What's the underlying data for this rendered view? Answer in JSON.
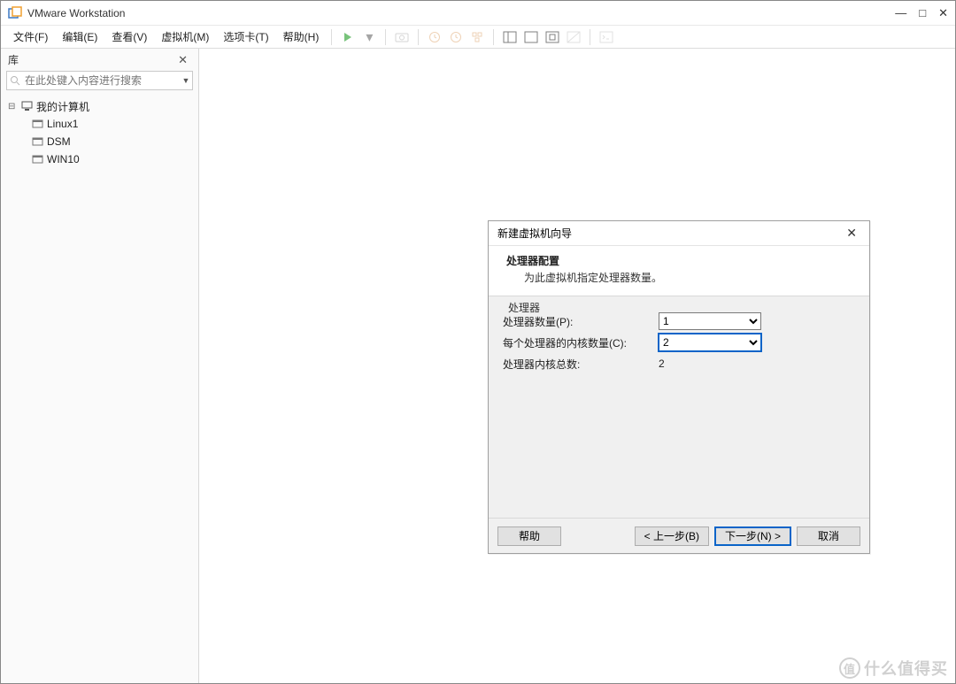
{
  "titlebar": {
    "app_name": "VMware Workstation"
  },
  "menubar": {
    "file": "文件(F)",
    "edit": "编辑(E)",
    "view": "查看(V)",
    "vm": "虚拟机(M)",
    "tabs": "选项卡(T)",
    "help": "帮助(H)"
  },
  "sidebar": {
    "title": "库",
    "search_placeholder": "在此处键入内容进行搜索",
    "root": "我的计算机",
    "items": [
      {
        "label": "Linux1"
      },
      {
        "label": "DSM"
      },
      {
        "label": "WIN10"
      }
    ]
  },
  "dialog": {
    "title": "新建虚拟机向导",
    "heading": "处理器配置",
    "subheading": "为此虚拟机指定处理器数量。",
    "group_label": "处理器",
    "rows": {
      "cpu_count_label": "处理器数量(P):",
      "cpu_count_value": "1",
      "cores_label": "每个处理器的内核数量(C):",
      "cores_value": "2",
      "total_label": "处理器内核总数:",
      "total_value": "2"
    },
    "buttons": {
      "help": "帮助",
      "back": "< 上一步(B)",
      "next": "下一步(N) >",
      "cancel": "取消"
    }
  },
  "watermark": "什么值得买"
}
